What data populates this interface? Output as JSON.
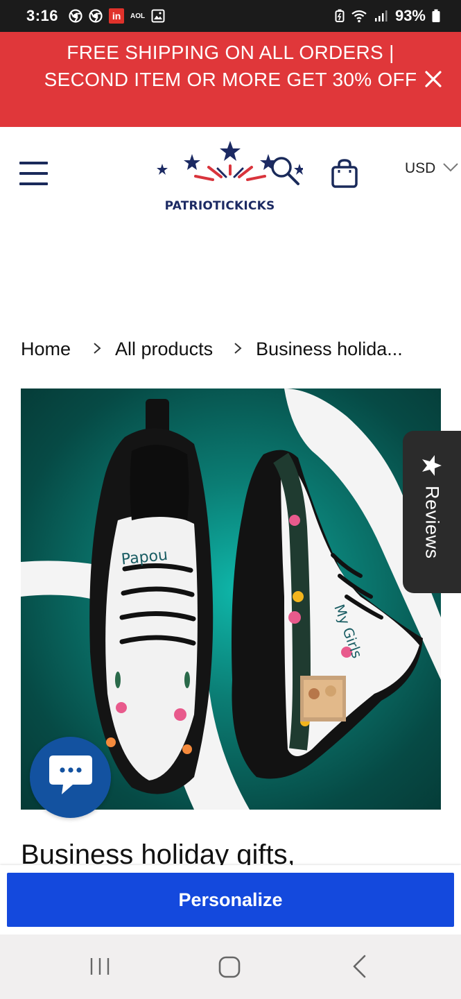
{
  "status_bar": {
    "time": "3:16",
    "notification_icons": [
      "chrome-icon",
      "chrome-icon",
      "linkedin-icon",
      "aol-icon",
      "gallery-icon"
    ],
    "linkedin_text": "in",
    "aol_text": "AOL",
    "battery": "93%"
  },
  "promo": {
    "text": "FREE SHIPPING ON ALL ORDERS | SECOND ITEM OR MORE GET 30% OFF",
    "bg_color": "#e0373a"
  },
  "header": {
    "logo_text": "PATRIOTICKICKS",
    "currency": "USD"
  },
  "breadcrumb": {
    "home": "Home",
    "all_products": "All products",
    "current": "Business holida..."
  },
  "product": {
    "image_text_left": "Papou",
    "image_text_right": "My Girls",
    "title": "Business holiday gifts,"
  },
  "reviews_tab": {
    "label": "Reviews"
  },
  "bottom": {
    "personalize_label": "Personalize",
    "button_color": "#1449dd"
  },
  "colors": {
    "accent": "#1449dd",
    "brand_navy": "#1c2a63",
    "brand_red": "#d9343c"
  }
}
